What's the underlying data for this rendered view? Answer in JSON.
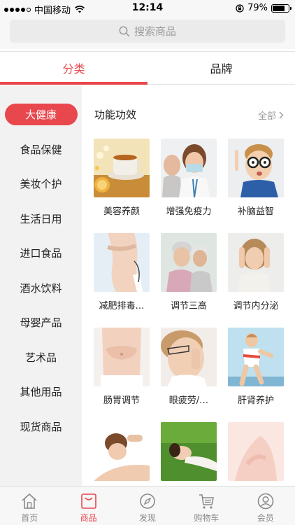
{
  "status_bar": {
    "carrier": "中国移动",
    "time": "12:14",
    "battery": "79%",
    "battery_level": 0.79
  },
  "search": {
    "placeholder": "搜索商品"
  },
  "tabs": [
    {
      "label": "分类",
      "active": true
    },
    {
      "label": "品牌",
      "active": false
    }
  ],
  "sidebar": {
    "items": [
      {
        "label": "大健康",
        "active": true
      },
      {
        "label": "食品保健"
      },
      {
        "label": "美妆个护"
      },
      {
        "label": "生活日用"
      },
      {
        "label": "进口食品"
      },
      {
        "label": "酒水饮料"
      },
      {
        "label": "母婴产品"
      },
      {
        "label": "艺术品"
      },
      {
        "label": "其他用品"
      },
      {
        "label": "现货商品"
      }
    ]
  },
  "section": {
    "title": "功能功效",
    "see_all": "全部"
  },
  "grid": {
    "items": [
      {
        "label": "美容养颜",
        "icon": "tea-photo"
      },
      {
        "label": "增强免疫力",
        "icon": "doctor-mask-photo"
      },
      {
        "label": "补脑益智",
        "icon": "boy-glasses-photo"
      },
      {
        "label": "减肥排毒…",
        "icon": "waist-photo"
      },
      {
        "label": "调节三高",
        "icon": "elderly-couple-photo"
      },
      {
        "label": "调节内分泌",
        "icon": "stressed-woman-photo"
      },
      {
        "label": "肠胃调节",
        "icon": "stomach-photo"
      },
      {
        "label": "眼疲劳/…",
        "icon": "tired-eyes-photo"
      },
      {
        "label": "肝肾养护",
        "icon": "runner-photo"
      },
      {
        "label": "",
        "icon": "massage-photo"
      },
      {
        "label": "",
        "icon": "grass-relax-photo"
      },
      {
        "label": "",
        "icon": "skin-photo"
      }
    ]
  },
  "bottom_nav": [
    {
      "label": "首页",
      "icon": "home-icon"
    },
    {
      "label": "商品",
      "icon": "bag-icon",
      "active": true
    },
    {
      "label": "发现",
      "icon": "compass-icon"
    },
    {
      "label": "购物车",
      "icon": "cart-icon"
    },
    {
      "label": "会员",
      "icon": "user-icon"
    }
  ],
  "colors": {
    "accent": "#e8474d",
    "sidebar_bg": "#f2f2f2",
    "bar_bg": "#f7f7f7"
  }
}
